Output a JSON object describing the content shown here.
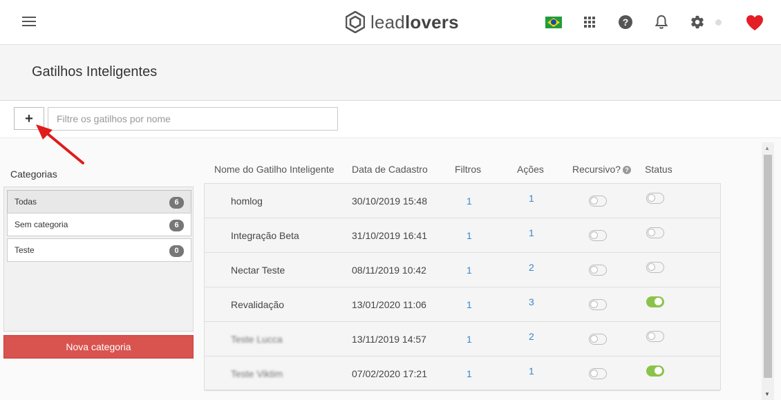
{
  "brand": {
    "logo_regular": "lead",
    "logo_bold": "lovers"
  },
  "page": {
    "title": "Gatilhos Inteligentes"
  },
  "toolbar": {
    "add_label": "+",
    "filter_placeholder": "Filtre os gatilhos por nome"
  },
  "sidebar": {
    "title": "Categorias",
    "categories": [
      {
        "label": "Todas",
        "count": "6",
        "active": true
      },
      {
        "label": "Sem categoria",
        "count": "6",
        "active": false
      },
      {
        "label": "Teste",
        "count": "0",
        "active": false
      }
    ],
    "new_category_label": "Nova categoria"
  },
  "table": {
    "headers": {
      "name": "Nome do Gatilho Inteligente",
      "date": "Data de Cadastro",
      "filters": "Filtros",
      "actions": "Ações",
      "recursive": "Recursivo?",
      "status": "Status"
    },
    "rows": [
      {
        "name": "homlog",
        "date": "30/10/2019 15:48",
        "filters": "1",
        "actions": "1",
        "recursive": false,
        "status": false,
        "redacted": false
      },
      {
        "name": "Integração Beta",
        "date": "31/10/2019 16:41",
        "filters": "1",
        "actions": "1",
        "recursive": false,
        "status": false,
        "redacted": false
      },
      {
        "name": "Nectar Teste",
        "date": "08/11/2019 10:42",
        "filters": "1",
        "actions": "2",
        "recursive": false,
        "status": false,
        "redacted": false
      },
      {
        "name": "Revalidação",
        "date": "13/01/2020 11:06",
        "filters": "1",
        "actions": "3",
        "recursive": false,
        "status": true,
        "redacted": false
      },
      {
        "name": "Teste Lucca",
        "date": "13/11/2019 14:57",
        "filters": "1",
        "actions": "2",
        "recursive": false,
        "status": false,
        "redacted": true
      },
      {
        "name": "Teste Viktim",
        "date": "07/02/2020 17:21",
        "filters": "1",
        "actions": "1",
        "recursive": false,
        "status": true,
        "redacted": true
      }
    ]
  },
  "colors": {
    "danger": "#d9534f",
    "link": "#3a87c8",
    "toggle_on": "#8bc34a",
    "heart": "#e31e24",
    "arrow": "#e01b1b"
  }
}
